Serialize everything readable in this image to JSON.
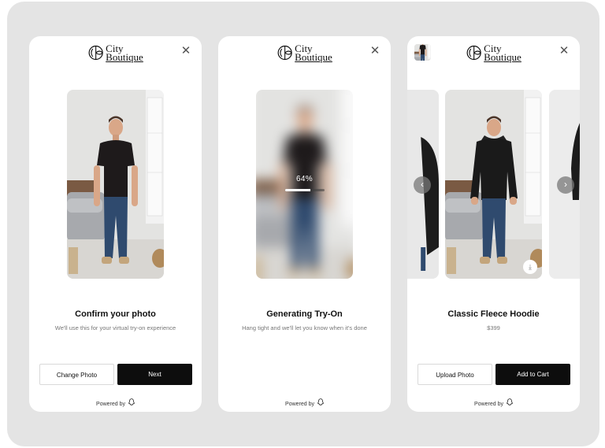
{
  "brand": {
    "line1": "City",
    "line2": "Boutique",
    "logo_icon": "boutique-monogram-icon"
  },
  "close_icon": "✕",
  "screens": [
    {
      "title": "Confirm your photo",
      "subtitle": "We'll use this for your virtual try-on experience",
      "secondary_button": "Change Photo",
      "primary_button": "Next",
      "powered_by": "Powered by"
    },
    {
      "title": "Generating Try-On",
      "subtitle": "Hang tight and we'll let you know when it's done",
      "progress_label": "64%",
      "progress_value": 0.64,
      "powered_by": "Powered by"
    },
    {
      "title": "Classic Fleece Hoodie",
      "price": "$399",
      "secondary_button": "Upload Photo",
      "primary_button": "Add to Cart",
      "powered_by": "Powered by"
    }
  ],
  "icons": {
    "prev": "‹",
    "next": "›",
    "download": "⤓",
    "ghost": "👻"
  },
  "colors": {
    "frame": "#e4e4e4",
    "primary": "#0d0d0d",
    "tee": "#1e1a1b",
    "hoodie": "#1a1a1a",
    "jeans": "#2f4a6e"
  }
}
